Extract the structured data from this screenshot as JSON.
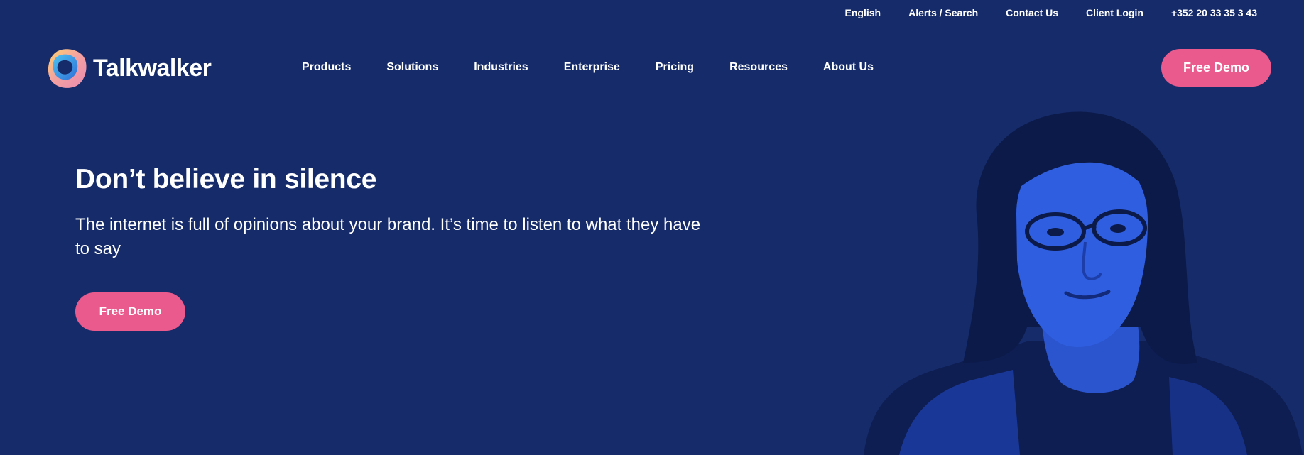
{
  "topbar": {
    "links": [
      "English",
      "Alerts / Search",
      "Contact Us",
      "Client Login",
      "+352 20 33 35 3 43"
    ]
  },
  "nav": {
    "logo_text": "Talkwalker",
    "items": [
      "Products",
      "Solutions",
      "Industries",
      "Enterprise",
      "Pricing",
      "Resources",
      "About Us"
    ],
    "cta_label": "Free Demo"
  },
  "hero": {
    "title": "Don’t believe in silence",
    "subtitle": "The internet is full of opinions about your brand. It’s time to listen to what they have to say",
    "cta_label": "Free Demo"
  },
  "colors": {
    "background": "#162b69",
    "accent": "#ea5a8c",
    "portrait_tint": "#2f5fe0"
  },
  "icons": {
    "logo": "talkwalker-blob-logo"
  }
}
